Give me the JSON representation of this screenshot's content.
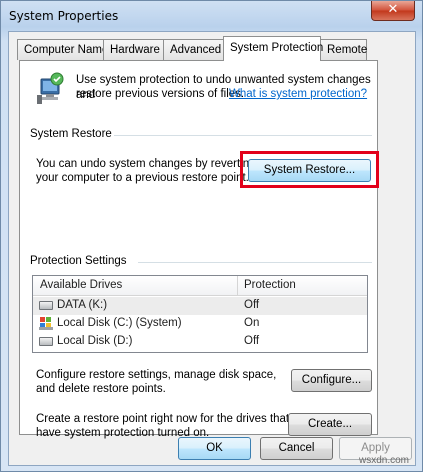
{
  "window": {
    "title": "System Properties",
    "close_glyph": "✕"
  },
  "tabs": [
    {
      "label": "Computer Name",
      "active": false
    },
    {
      "label": "Hardware",
      "active": false
    },
    {
      "label": "Advanced",
      "active": false
    },
    {
      "label": "System Protection",
      "active": true
    },
    {
      "label": "Remote",
      "active": false
    }
  ],
  "intro": {
    "icon": "system-protection-icon",
    "text_line1": "Use system protection to undo unwanted system changes and",
    "text_line2": "restore previous versions of files.",
    "link": "What is system protection?"
  },
  "system_restore": {
    "heading": "System Restore",
    "text_line1": "You can undo system changes by reverting",
    "text_line2": "your computer to a previous restore point.",
    "button": "System Restore...",
    "highlight_color": "#e2001a"
  },
  "protection": {
    "heading": "Protection Settings",
    "columns": [
      "Available Drives",
      "Protection"
    ],
    "rows": [
      {
        "drive": "DATA (K:)",
        "protection": "Off",
        "icon": "drive-icon",
        "selected": true
      },
      {
        "drive": "Local Disk (C:) (System)",
        "protection": "On",
        "icon": "windows-drive-icon",
        "selected": false
      },
      {
        "drive": "Local Disk (D:)",
        "protection": "Off",
        "icon": "drive-icon",
        "selected": false
      }
    ],
    "configure_text_line1": "Configure restore settings, manage disk space,",
    "configure_text_line2": "and delete restore points.",
    "configure_button": "Configure...",
    "create_text_line1": "Create a restore point right now for the drives that",
    "create_text_line2": "have system protection turned on.",
    "create_button": "Create..."
  },
  "footer": {
    "ok": "OK",
    "cancel": "Cancel",
    "apply": "Apply"
  },
  "watermark": "wsxdn.com"
}
